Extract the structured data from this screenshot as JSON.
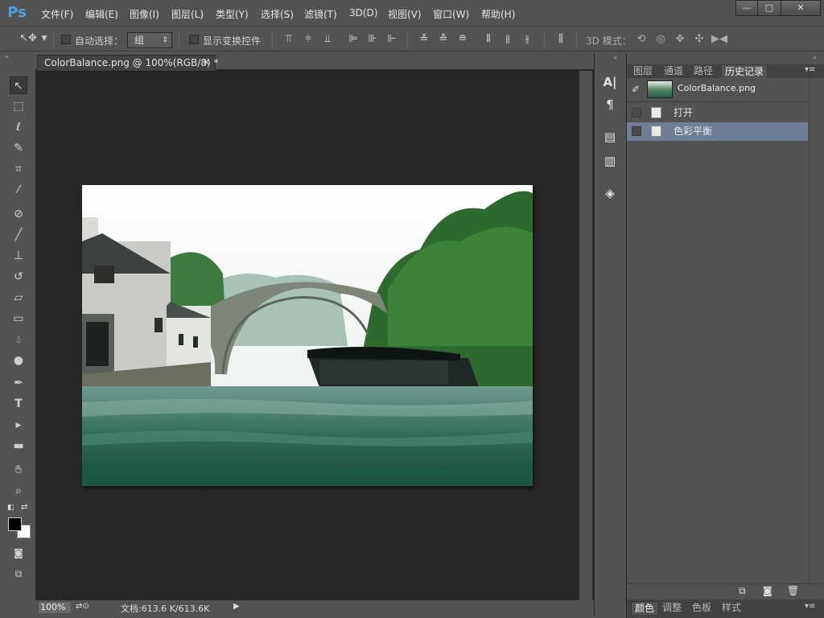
{
  "app": {
    "logo": "Ps"
  },
  "menu": [
    "文件(F)",
    "编辑(E)",
    "图像(I)",
    "图层(L)",
    "类型(Y)",
    "选择(S)",
    "滤镜(T)",
    "3D(D)",
    "视图(V)",
    "窗口(W)",
    "帮助(H)"
  ],
  "window_controls": {
    "minimize": "—",
    "maximize": "□",
    "close": "✕"
  },
  "options": {
    "auto_select_label": "自动选择：",
    "auto_select_value": "组",
    "show_transform_label": "显示变换控件",
    "mode_3d_label": "3D 模式："
  },
  "document": {
    "tab_title": "ColorBalance.png @ 100%(RGB/8) *",
    "close_glyph": "✕"
  },
  "status": {
    "zoom": "100%",
    "doc_info": "文档:613.6 K/613.6K"
  },
  "panel": {
    "tabs": [
      "图层",
      "通道",
      "路径",
      "历史记录"
    ],
    "active_tab": "历史记录",
    "snapshot_label": "ColorBalance.png",
    "history": [
      {
        "label": "打开",
        "selected": false
      },
      {
        "label": "色彩平衡",
        "selected": true
      }
    ],
    "bottom_tabs": [
      "颜色",
      "调整",
      "色板",
      "样式"
    ],
    "active_bottom_tab": "颜色"
  },
  "colors": {
    "ui_bg": "#535353",
    "canvas_bg": "#282828",
    "history_selected": "#6f7d95",
    "logo": "#4aa0e0"
  }
}
